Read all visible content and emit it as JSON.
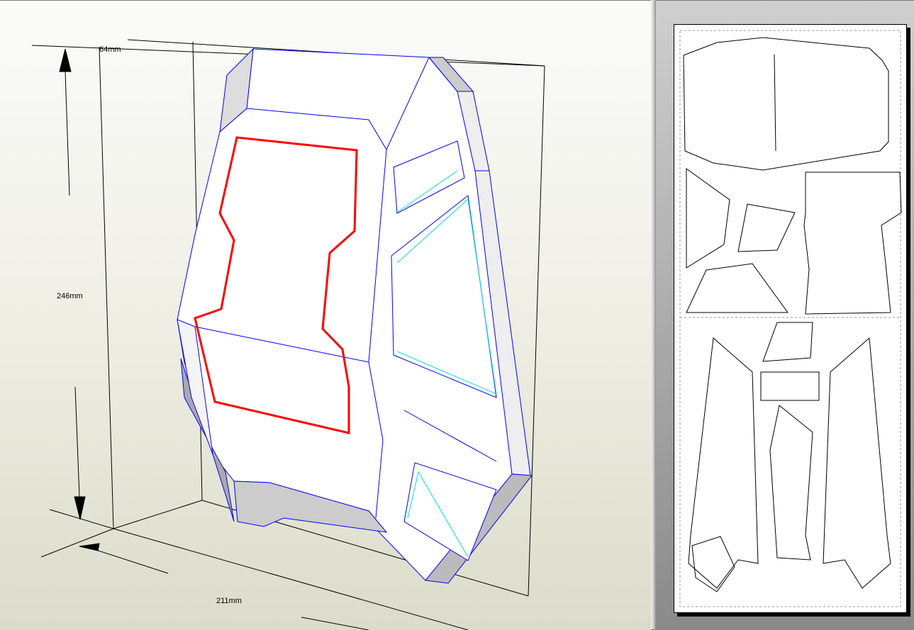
{
  "view3d": {
    "dimensions": {
      "depth": "64mm",
      "height": "246mm",
      "width": "211mm"
    },
    "colors": {
      "edge": "#0000ff",
      "selected": "#ff0000",
      "fold": "#00e0e0"
    }
  },
  "view2d": {
    "page_count": 1
  }
}
